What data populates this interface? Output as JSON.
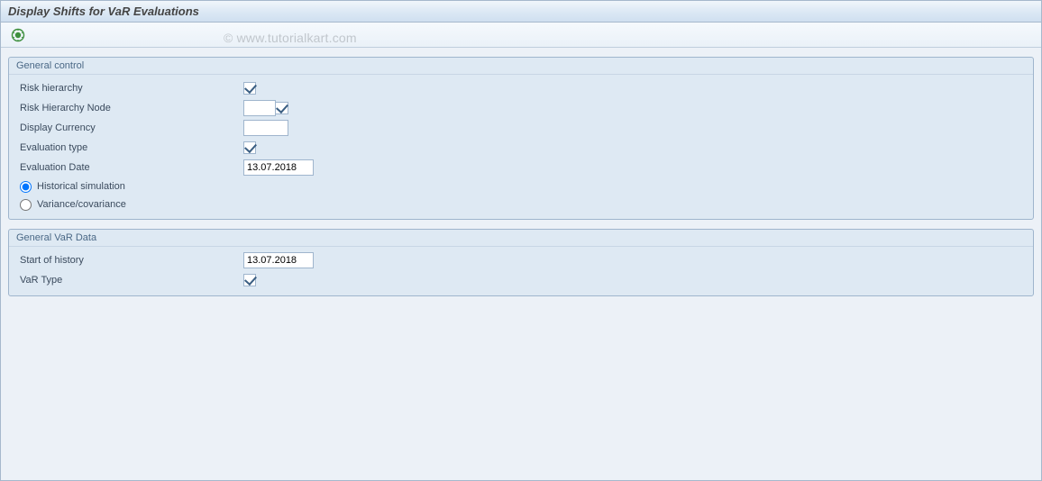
{
  "window": {
    "title": "Display Shifts for VaR Evaluations"
  },
  "toolbar": {
    "execute_icon": "execute-icon"
  },
  "watermark": "© www.tutorialkart.com",
  "groups": {
    "general_control": {
      "title": "General control",
      "fields": {
        "risk_hierarchy_label": "Risk hierarchy",
        "risk_hierarchy_checked": true,
        "risk_hierarchy_node_label": "Risk Hierarchy Node",
        "risk_hierarchy_node_value": "",
        "risk_hierarchy_node_checked": true,
        "display_currency_label": "Display Currency",
        "display_currency_value": "",
        "evaluation_type_label": "Evaluation type",
        "evaluation_type_checked": true,
        "evaluation_date_label": "Evaluation Date",
        "evaluation_date_value": "13.07.2018",
        "radio_historical_label": "Historical simulation",
        "radio_variance_label": "Variance/covariance",
        "radio_selected": "historical"
      }
    },
    "general_var": {
      "title": "General VaR Data",
      "fields": {
        "start_history_label": "Start of history",
        "start_history_value": "13.07.2018",
        "var_type_label": "VaR Type",
        "var_type_checked": true
      }
    }
  }
}
